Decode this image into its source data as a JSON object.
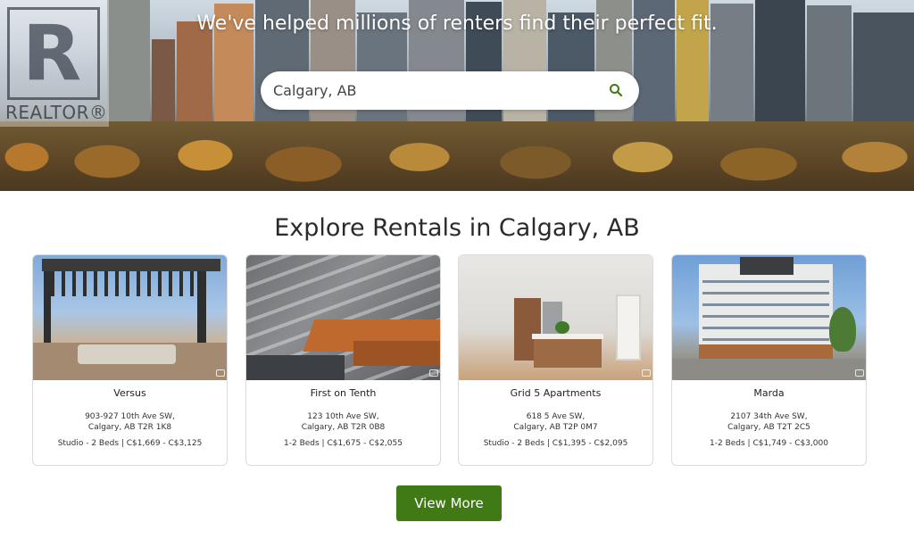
{
  "hero": {
    "title": "We've helped millions of renters find their perfect fit.",
    "logo_text": "REALTOR®",
    "logo_letter": "R"
  },
  "search": {
    "value": "Calgary, AB",
    "icon": "search-icon",
    "icon_color": "#3f7a14"
  },
  "section": {
    "title": "Explore Rentals in Calgary, AB"
  },
  "listings": [
    {
      "name": "Versus",
      "address_line1": "903-927 10th Ave SW,",
      "address_line2": "Calgary, AB T2R 1K8",
      "info": "Studio - 2 Beds | C$1,669 - C$3,125"
    },
    {
      "name": "First on Tenth",
      "address_line1": "123 10th Ave SW,",
      "address_line2": "Calgary, AB T2R 0B8",
      "info": "1-2 Beds | C$1,675 - C$2,055"
    },
    {
      "name": "Grid 5 Apartments",
      "address_line1": "618 5 Ave SW,",
      "address_line2": "Calgary, AB T2P 0M7",
      "info": "Studio - 2 Beds | C$1,395 - C$2,095"
    },
    {
      "name": "Marda",
      "address_line1": "2107 34th Ave SW,",
      "address_line2": "Calgary, AB T2T 2C5",
      "info": "1-2 Beds | C$1,749 - C$3,000"
    }
  ],
  "view_more": {
    "label": "View More",
    "color": "#3f7a14"
  }
}
